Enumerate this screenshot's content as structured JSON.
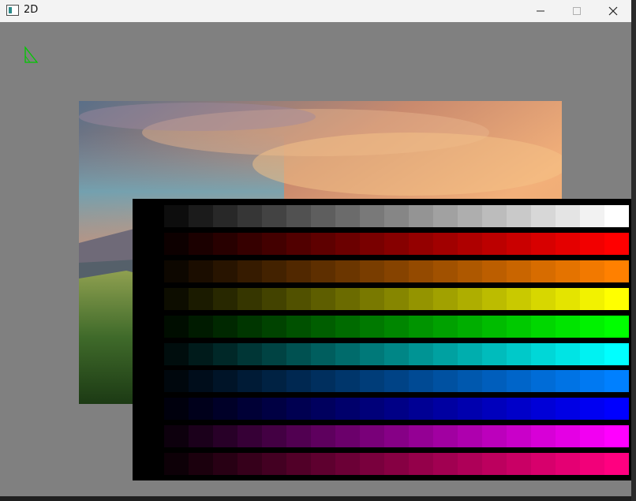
{
  "window": {
    "title": "2D"
  },
  "titlebar": {
    "minimize_icon": "minimize-icon",
    "maximize_icon": "maximize-icon",
    "close_icon": "close-icon"
  },
  "canvas": {
    "background": "#808080",
    "triangle_color": "#00c800",
    "palette": {
      "background": "#000000",
      "steps": 19,
      "rows": [
        {
          "name": "gray",
          "end": "#ffffff"
        },
        {
          "name": "red",
          "end": "#ff0000"
        },
        {
          "name": "orange",
          "end": "#ff8000"
        },
        {
          "name": "yellow",
          "end": "#ffff00"
        },
        {
          "name": "green",
          "end": "#00ff00"
        },
        {
          "name": "cyan",
          "end": "#00ffff"
        },
        {
          "name": "azure",
          "end": "#0080ff"
        },
        {
          "name": "blue",
          "end": "#0000ff"
        },
        {
          "name": "magenta",
          "end": "#ff00ff"
        },
        {
          "name": "pink",
          "end": "#ff0080"
        }
      ]
    }
  }
}
